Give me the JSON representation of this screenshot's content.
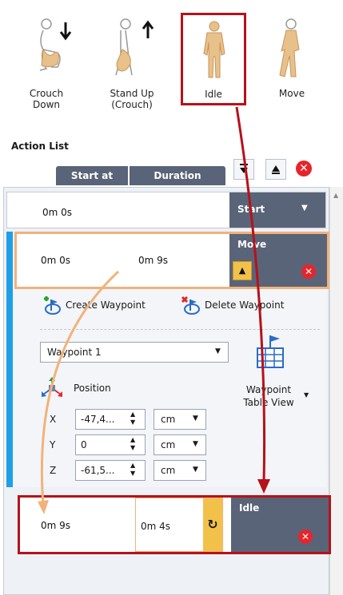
{
  "colors": {
    "accent_blue": "#1fa0e6",
    "header_slate": "#5a6478",
    "highlight_orange": "#f2b27a",
    "highlight_red": "#b5121b",
    "yellow_button": "#f2c14a",
    "delete_red": "#e8242b"
  },
  "action_bar": [
    {
      "label": "Crouch\nDown",
      "icon": "crouch-down-icon"
    },
    {
      "label": "Stand Up\n(Crouch)",
      "icon": "stand-up-icon"
    },
    {
      "label": "Idle",
      "icon": "idle-icon"
    },
    {
      "label": "Move",
      "icon": "move-icon"
    }
  ],
  "action_list": {
    "title": "Action List",
    "columns": {
      "start_at": "Start at",
      "duration": "Duration"
    },
    "buttons": [
      "move-down-icon",
      "move-up-icon",
      "delete-icon"
    ],
    "rows": [
      {
        "start": "0m 0s",
        "duration": "",
        "name": "Start"
      },
      {
        "start": "0m 0s",
        "duration": "0m 9s",
        "name": "Move"
      },
      {
        "start": "0m 9s",
        "duration": "0m 4s",
        "name": "Idle"
      }
    ],
    "waypoint": {
      "create_label": "Create Waypoint",
      "delete_label": "Delete Waypoint",
      "selected": "Waypoint 1",
      "position_label": "Position",
      "table_view_label": "Waypoint\nTable View",
      "coords": [
        {
          "axis": "X",
          "value": "-47,4...",
          "unit": "cm"
        },
        {
          "axis": "Y",
          "value": "0",
          "unit": "cm"
        },
        {
          "axis": "Z",
          "value": "-61,5...",
          "unit": "cm"
        }
      ]
    }
  }
}
